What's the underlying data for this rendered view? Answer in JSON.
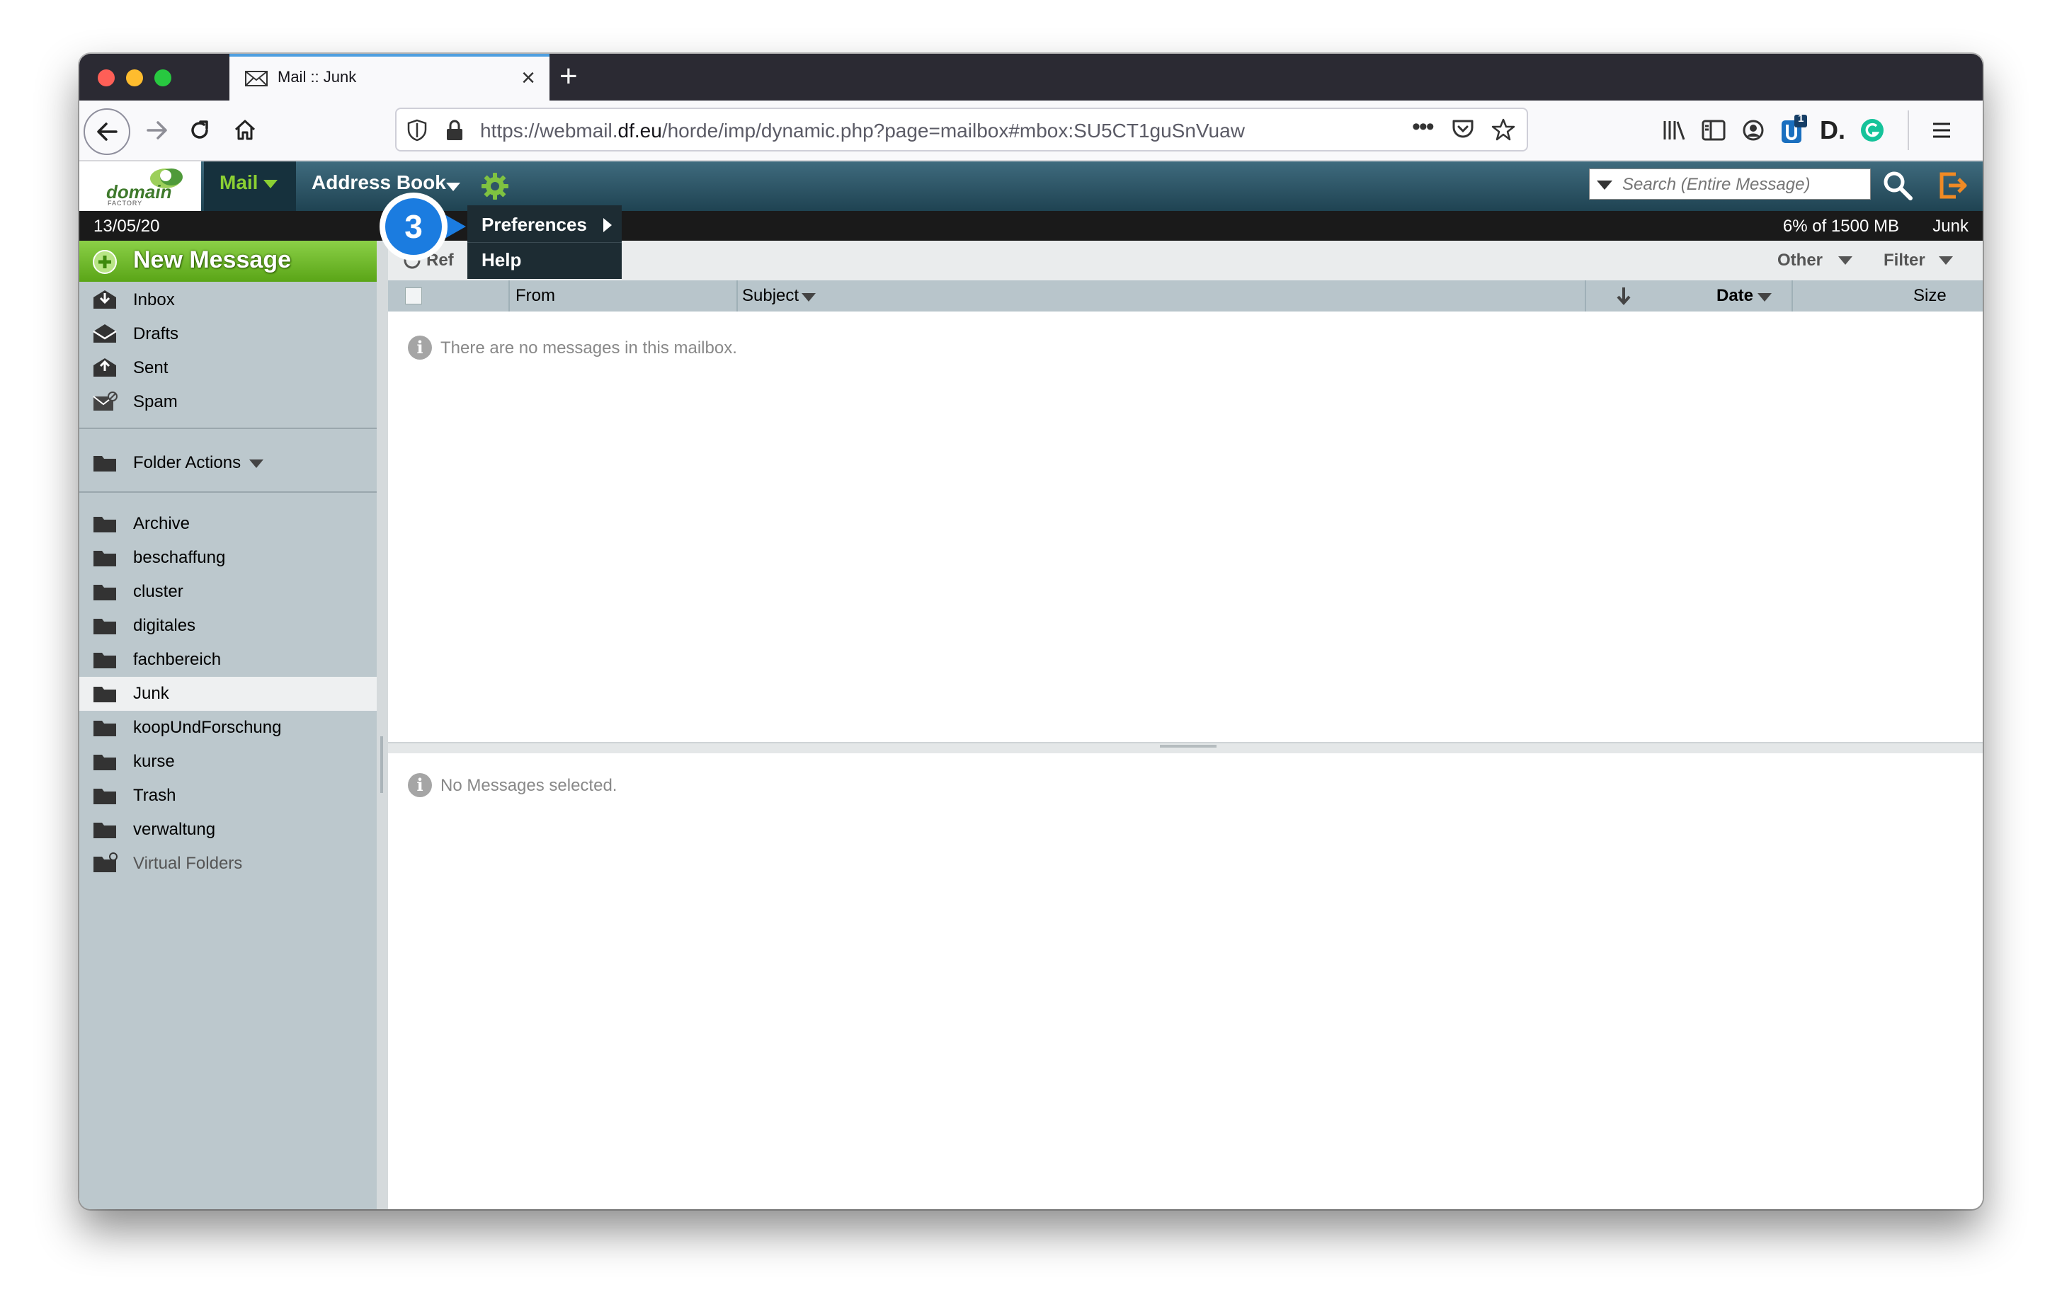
{
  "browser": {
    "tab_title": "Mail :: Junk",
    "url_prefix": "https://webmail.",
    "url_domain": "df.eu",
    "url_suffix": "/horde/imp/dynamic.php?page=mailbox#mbox:SU5CT1guSnVuaw",
    "extension_badge": "1",
    "icons": [
      "back-icon",
      "forward-icon",
      "reload-icon",
      "home-icon",
      "shield-icon",
      "lock-icon",
      "more-icon",
      "pocket-icon",
      "bookmark-star-icon",
      "library-icon",
      "sidebar-icon",
      "account-icon",
      "extension-icon",
      "d-icon",
      "grammarly-icon",
      "menu-icon"
    ]
  },
  "header": {
    "logo_text": "domain",
    "logo_subtext": "FACTORY",
    "mail_label": "Mail",
    "address_book_label": "Address Book",
    "search_placeholder": "Search (Entire Message)"
  },
  "status": {
    "date": "13/05/20",
    "quota": "6% of 1500 MB",
    "mailbox": "Junk"
  },
  "popup_menu": {
    "callout_number": "3",
    "items": [
      {
        "label": "Preferences"
      },
      {
        "label": "Help"
      }
    ]
  },
  "sidebar": {
    "new_message": "New Message",
    "system_folders": [
      {
        "label": "Inbox",
        "icon": "inbox-icon"
      },
      {
        "label": "Drafts",
        "icon": "drafts-icon"
      },
      {
        "label": "Sent",
        "icon": "sent-icon"
      },
      {
        "label": "Spam",
        "icon": "spam-icon"
      }
    ],
    "folder_actions": "Folder Actions",
    "folders": [
      {
        "label": "Archive"
      },
      {
        "label": "beschaffung"
      },
      {
        "label": "cluster"
      },
      {
        "label": "digitales"
      },
      {
        "label": "fachbereich"
      },
      {
        "label": "Junk",
        "active": true
      },
      {
        "label": "koopUndForschung"
      },
      {
        "label": "kurse"
      },
      {
        "label": "Trash"
      },
      {
        "label": "verwaltung"
      },
      {
        "label": "Virtual Folders"
      }
    ]
  },
  "toolbar": {
    "refresh_label_partial": "Ref",
    "other_label": "Other",
    "filter_label": "Filter"
  },
  "columns": {
    "from": "From",
    "subject": "Subject",
    "date": "Date",
    "size": "Size"
  },
  "messages": {
    "empty_text": "There are no messages in this mailbox.",
    "preview_empty_text": "No Messages selected."
  },
  "colors": {
    "brand_green": "#8bcf33",
    "header_teal": "#2e5566",
    "sidebar_bg": "#bcc8cd",
    "callout_blue": "#1b7ce0"
  }
}
